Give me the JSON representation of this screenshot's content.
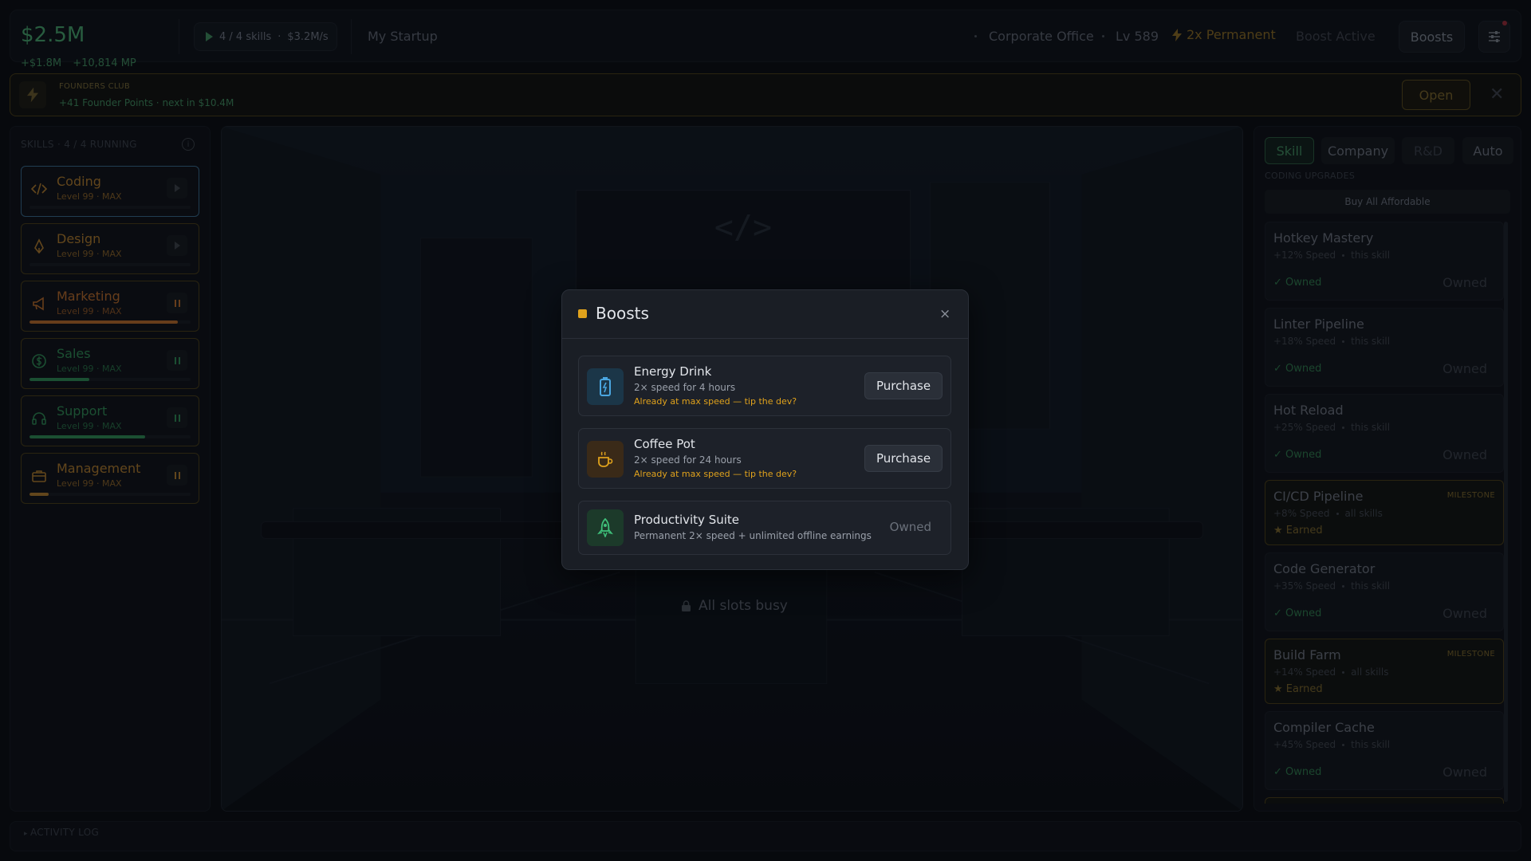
{
  "header": {
    "cash": "$2.5M",
    "cash_delta": "+$1.8M",
    "mp_delta": "+10,814 MP",
    "skills_running": "4 / 4 skills",
    "rate": "$3.2M/s",
    "startup_name": "My Startup",
    "office": "Corporate Office",
    "level": "Lv 589",
    "multiplier": "2x Permanent",
    "boost_status": "Boost Active",
    "boosts_button": "Boosts"
  },
  "founders": {
    "title": "FOUNDERS CLUB",
    "points": "+41 Founder Points",
    "next": "next in $10.4M",
    "open_button": "Open",
    "close_symbol": "✕"
  },
  "skills_panel": {
    "header": "SKILLS",
    "running": "4 / 4 RUNNING",
    "info_symbol": "i",
    "items": [
      {
        "name": "Coding",
        "level": "Level 99",
        "status": "MAX",
        "state": "play",
        "progress": 0.0,
        "color": "#b07a2a",
        "icon": "code-icon"
      },
      {
        "name": "Design",
        "level": "Level 99",
        "status": "MAX",
        "state": "play",
        "progress": 0.0,
        "color": "#b07a2a",
        "icon": "pen-nib-icon"
      },
      {
        "name": "Marketing",
        "level": "Level 99",
        "status": "MAX",
        "state": "pause",
        "progress": 0.92,
        "color": "#b86a28",
        "icon": "megaphone-icon"
      },
      {
        "name": "Sales",
        "level": "Level 99",
        "status": "MAX",
        "state": "pause",
        "progress": 0.37,
        "color": "#2f8a52",
        "icon": "dollar-coin-icon"
      },
      {
        "name": "Support",
        "level": "Level 99",
        "status": "MAX",
        "state": "pause",
        "progress": 0.72,
        "color": "#2f8a52",
        "icon": "headset-icon"
      },
      {
        "name": "Management",
        "level": "Level 99",
        "status": "MAX",
        "state": "pause",
        "progress": 0.12,
        "color": "#b07a2a",
        "icon": "briefcase-icon"
      }
    ]
  },
  "scene": {
    "slots_status": "All slots busy"
  },
  "right_panel": {
    "tabs": [
      "Skill",
      "Company",
      "R&D",
      "Auto"
    ],
    "section": "CODING UPGRADES",
    "buy_all": "Buy All Affordable",
    "upgrades": [
      {
        "name": "Hotkey Mastery",
        "stat": "+12% Speed",
        "scope": "this skill",
        "status": "✓ Owned",
        "right": "Owned",
        "milestone": false
      },
      {
        "name": "Linter Pipeline",
        "stat": "+18% Speed",
        "scope": "this skill",
        "status": "✓ Owned",
        "right": "Owned",
        "milestone": false
      },
      {
        "name": "Hot Reload",
        "stat": "+25% Speed",
        "scope": "this skill",
        "status": "✓ Owned",
        "right": "Owned",
        "milestone": false
      },
      {
        "name": "CI/CD Pipeline",
        "stat": "+8% Speed",
        "scope": "all skills",
        "status": "★ Earned",
        "badge": "MILESTONE",
        "milestone": true
      },
      {
        "name": "Code Generator",
        "stat": "+35% Speed",
        "scope": "this skill",
        "status": "✓ Owned",
        "right": "Owned",
        "milestone": false
      },
      {
        "name": "Build Farm",
        "stat": "+14% Speed",
        "scope": "all skills",
        "status": "★ Earned",
        "badge": "MILESTONE",
        "milestone": true
      },
      {
        "name": "Compiler Cache",
        "stat": "+45% Speed",
        "scope": "this skill",
        "status": "✓ Owned",
        "right": "Owned",
        "milestone": false
      }
    ]
  },
  "activity_log": {
    "label": "ACTIVITY LOG"
  },
  "modal": {
    "title": "Boosts",
    "close_symbol": "×",
    "items": [
      {
        "name": "Energy Drink",
        "desc": "2× speed for 4 hours",
        "warning": "Already at max speed — tip the dev?",
        "action": "Purchase",
        "icon": "battery-icon",
        "icon_bg": "#1b3648"
      },
      {
        "name": "Coffee Pot",
        "desc": "2× speed for 24 hours",
        "warning": "Already at max speed — tip the dev?",
        "action": "Purchase",
        "icon": "coffee-icon",
        "icon_bg": "#3a2a18"
      },
      {
        "name": "Productivity Suite",
        "desc": "Permanent 2× speed + unlimited offline earnings",
        "action": "Owned",
        "icon": "rocket-icon",
        "icon_bg": "#1c3a2a"
      }
    ]
  },
  "colors": {
    "accent_green": "#3f8a5c",
    "accent_gold": "#e0a21c",
    "modal_bg": "#1a1e25"
  }
}
